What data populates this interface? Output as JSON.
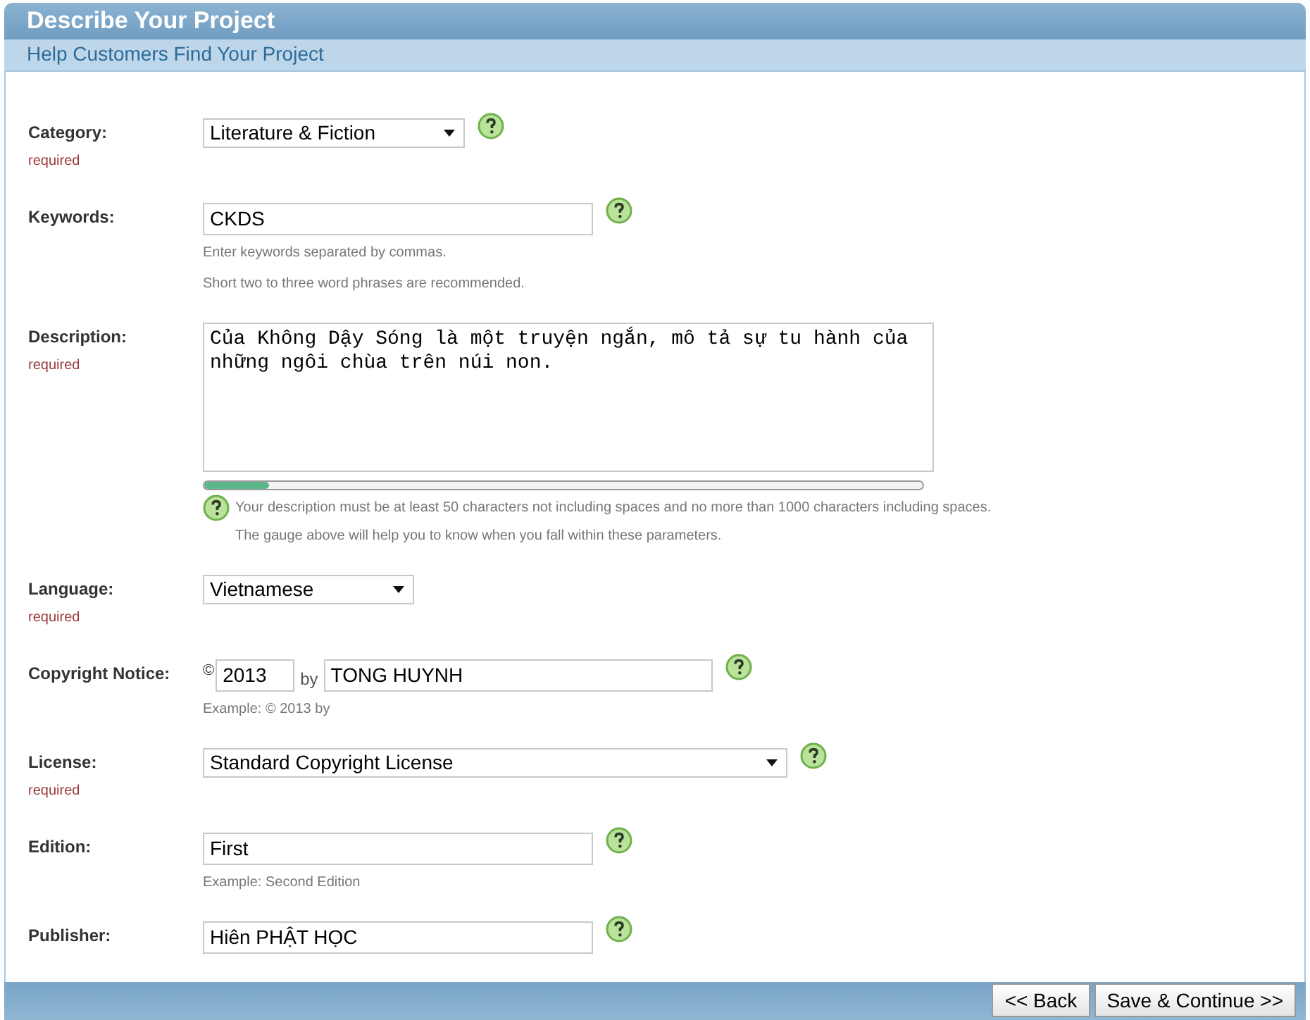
{
  "title": "Describe Your Project",
  "subtitle": "Help Customers Find Your Project",
  "fields": [
    {
      "kind": "select",
      "label": "Category:",
      "required_note": "required",
      "value": "Literature & Fiction",
      "help_icon": true
    },
    {
      "kind": "text",
      "label": "Keywords:",
      "value": "CKDS",
      "help_icon": true,
      "hints": [
        "Enter keywords separated by commas.",
        "Short two to three word phrases are recommended."
      ]
    },
    {
      "kind": "textarea",
      "label": "Description:",
      "required_note": "required",
      "value": "Của Không Dậy Sóng là một truyện ngắn, mô tả sự tu hành của những ngôi chùa trên núi non.",
      "help_icon": false,
      "gauge": {
        "level": 0.09
      },
      "notes": [
        "Your description must be at least 50 characters not including spaces and no more than 1000 characters including spaces.",
        "The gauge above will help you to know when you fall within these parameters."
      ]
    },
    {
      "kind": "select",
      "label": "Language:",
      "required_note": "required",
      "value": "Vietnamese",
      "help_icon": false
    },
    {
      "kind": "copyright",
      "label": "Copyright Notice:",
      "symbol": "©",
      "year": "2013",
      "by": "by",
      "value": "TONG HUYNH",
      "help_icon": true,
      "hints": [
        "Example: © 2013 by"
      ]
    },
    {
      "kind": "select",
      "label": "License:",
      "required_note": "required",
      "value": "Standard Copyright License",
      "help_icon": true
    },
    {
      "kind": "text",
      "label": "Edition:",
      "value": "First",
      "help_icon": true,
      "hints": [
        "Example: Second Edition"
      ]
    },
    {
      "kind": "text",
      "label": "Publisher:",
      "value": "Hiên PHẬT HỌC",
      "help_icon": true
    }
  ],
  "buttons": [
    {
      "label": "<< Back"
    },
    {
      "label": "Save & Continue >>"
    }
  ]
}
